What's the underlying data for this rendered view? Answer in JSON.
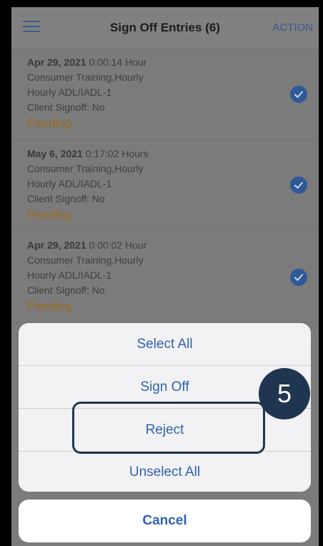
{
  "header": {
    "menu_icon": "hamburger-menu-icon",
    "title": "Sign Off Entries (6)",
    "action_label": "ACTION"
  },
  "entries": [
    {
      "date": "Apr 29, 2021",
      "duration": " 0:00:14 Hour",
      "service": "Consumer Training,Hourly",
      "code": "Hourly ADL/IADL-1",
      "client_signoff": "Client Signoff: No",
      "status": "Pending",
      "selected": true
    },
    {
      "date": "May 6, 2021",
      "duration": " 0:17:02 Hours",
      "service": "Consumer Training,Hourly",
      "code": "Hourly ADL/IADL-1",
      "client_signoff": "Client Signoff: No",
      "status": "Pending",
      "selected": true
    },
    {
      "date": "Apr 29, 2021",
      "duration": " 0:00:02 Hour",
      "service": "Consumer Training,Hourly",
      "code": "Hourly ADL/IADL-1",
      "client_signoff": "Client Signoff: No",
      "status": "Pending",
      "selected": true
    }
  ],
  "action_sheet": {
    "options": [
      {
        "label": "Select All"
      },
      {
        "label": "Sign Off"
      },
      {
        "label": "Reject"
      },
      {
        "label": "Unselect All"
      }
    ],
    "cancel_label": "Cancel"
  },
  "annotation": {
    "step_number": "5"
  },
  "colors": {
    "accent": "#2f63b0",
    "pending": "#9b6a1e",
    "annotation": "#1f3550"
  }
}
